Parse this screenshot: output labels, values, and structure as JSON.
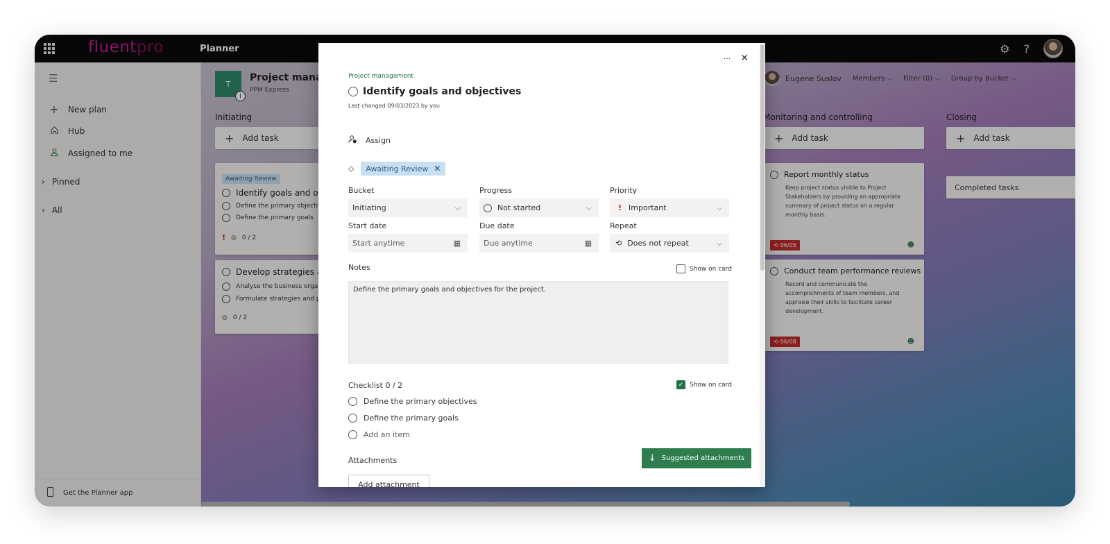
{
  "topbar": {
    "logo_part1": "fluent",
    "logo_part2": "pro",
    "app_name": "Planner",
    "settings_symbol": "⚙",
    "help_symbol": "?"
  },
  "sidebar": {
    "items": [
      {
        "label": "New plan",
        "icon": "plus-icon"
      },
      {
        "label": "Hub",
        "icon": "home-icon"
      },
      {
        "label": "Assigned to me",
        "icon": "person-icon"
      }
    ],
    "groups": [
      {
        "label": "Pinned"
      },
      {
        "label": "All"
      }
    ],
    "footer_label": "Get the Planner app"
  },
  "board": {
    "plan_badge_letter": "T",
    "plan_title": "Project manage",
    "plan_subtitle": "PPM Express",
    "user_name": "Eugene Suslov",
    "members_label": "Members",
    "filter_label": "Filter (0)",
    "group_label": "Group by Bucket",
    "columns": [
      {
        "title": "Initiating",
        "add_label": "Add task"
      },
      {
        "title": "Monitoring and controlling",
        "add_label": "Add task"
      },
      {
        "title": "Closing",
        "add_label": "Add task"
      }
    ],
    "initiating_cards": [
      {
        "tag": "Awaiting Review",
        "title": "Identify goals and objec",
        "items": [
          "Define the primary objective",
          "Define the primary goals"
        ],
        "priority_mark": "!",
        "progress": "0 / 2"
      },
      {
        "title": "Develop strategies and",
        "items": [
          "Analyse the business organi",
          "Formulate strategies and pl"
        ],
        "progress": "0 / 2"
      }
    ],
    "monitoring_cards": [
      {
        "title": "Report monthly status",
        "desc": "Keep project status visible to Project Stakeholders by providing an appropriate summary of project status on a regular monthly basis.",
        "date": "06/05"
      },
      {
        "title": "Conduct team performance reviews",
        "desc": "Record and communicate the accomplishments of team members, and appraise their skills to facilitate career development.",
        "date": "06/08"
      }
    ],
    "completed_label": "Completed tasks"
  },
  "modal": {
    "more_symbol": "···",
    "close_symbol": "✕",
    "plan_name": "Project management",
    "task_title": "Identify goals and objectives",
    "last_changed": "Last changed 09/03/2023 by you",
    "assign_label": "Assign",
    "label_tag": "Awaiting Review",
    "bucket": {
      "label": "Bucket",
      "value": "Initiating"
    },
    "progress": {
      "label": "Progress",
      "value": "Not started"
    },
    "priority": {
      "label": "Priority",
      "value": "Important",
      "mark": "!"
    },
    "start_date": {
      "label": "Start date",
      "placeholder": "Start anytime"
    },
    "due_date": {
      "label": "Due date",
      "placeholder": "Due anytime"
    },
    "repeat": {
      "label": "Repeat",
      "value": "Does not repeat"
    },
    "notes_label": "Notes",
    "notes_show_on_card": "Show on card",
    "notes_text": "Define the primary goals and objectives for the project.",
    "checklist_label": "Checklist 0 / 2",
    "checklist_show_on_card": "Show on card",
    "checklist_items": [
      "Define the primary objectives",
      "Define the primary goals"
    ],
    "add_item_label": "Add an item",
    "attachments_label": "Attachments",
    "suggested_label": "Suggested attachments",
    "add_attachment_label": "Add attachment"
  },
  "colors": {
    "accent_green": "#217346",
    "tag_blue": "#c7dff3",
    "overdue_red": "#c12a2a",
    "priority_red": "#c50f1f"
  }
}
